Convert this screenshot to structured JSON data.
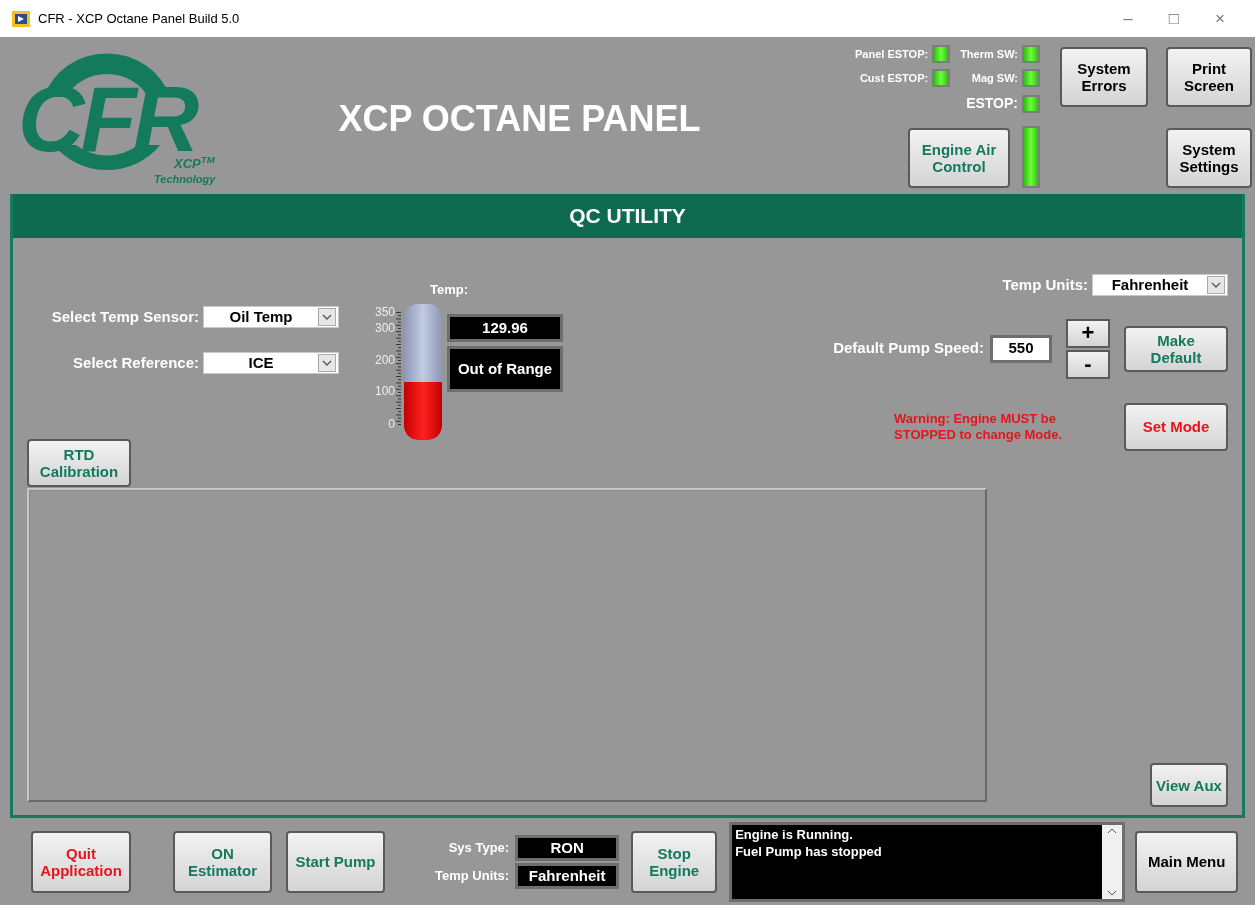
{
  "window": {
    "title": "CFR - XCP Octane Panel Build 5.0",
    "controls": [
      "–",
      "□",
      "×"
    ]
  },
  "header": {
    "logo": {
      "letters": "CFR",
      "mark": "XCP$^{TM}$",
      "sub": "Technology"
    },
    "title": "XCP OCTANE PANEL",
    "estop_lights": [
      {
        "label": "Panel ESTOP:",
        "on": true
      },
      {
        "label": "Cust ESTOP:",
        "on": true
      }
    ],
    "switch_lights": [
      {
        "label": "Therm SW:",
        "on": true,
        "kind": "small"
      },
      {
        "label": "Mag SW:",
        "on": true,
        "kind": "small"
      },
      {
        "label": "ESTOP:",
        "on": true,
        "kind": "large"
      }
    ],
    "engine_air": {
      "label": "Engine Air Control",
      "kind": "action",
      "on": true
    },
    "system_errors": {
      "label": "System Errors",
      "kind": "plain"
    },
    "print_screen": {
      "label": "Print Screen",
      "kind": "plain"
    },
    "system_settings": {
      "label": "System Settings",
      "kind": "plain"
    }
  },
  "section": {
    "title": "QC UTILITY"
  },
  "temp_sensor": {
    "label": "Select Temp Sensor:",
    "value": "Oil Temp"
  },
  "reference": {
    "label": "Select Reference:",
    "value": "ICE"
  },
  "rtd_button": {
    "label": "RTD Calibration",
    "kind": "action"
  },
  "thermometer": {
    "label": "Temp:",
    "scale": [
      "350",
      "300",
      "200",
      "100",
      "0"
    ],
    "level": 0.371,
    "reading": "129.96",
    "status": "Out of Range"
  },
  "temp_units": {
    "label": "Temp Units:",
    "value": "Fahrenheit"
  },
  "pump_speed": {
    "label": "Default Pump Speed:",
    "value": "550",
    "increment": "+",
    "decrement": "-"
  },
  "make_default": {
    "label": "Make Default",
    "kind": "action"
  },
  "warning": "Warning:  Engine MUST be STOPPED to change Mode.",
  "set_mode": {
    "label": "Set Mode",
    "kind": "danger"
  },
  "view_aux": {
    "label": "View Aux",
    "kind": "action"
  },
  "footer": {
    "buttons": [
      {
        "label": "Quit Application",
        "kind": "danger"
      },
      {
        "label": "ON Estimator",
        "kind": "action"
      },
      {
        "label": "Start Pump",
        "kind": "action"
      }
    ],
    "sys_type": {
      "label": "Sys Type:",
      "value": "RON"
    },
    "temp_units": {
      "label": "Temp Units:",
      "value": "Fahrenheit"
    },
    "stop_engine": {
      "label": "Stop Engine",
      "kind": "action"
    },
    "messages": [
      "Engine is Running.",
      "Fuel Pump has stopped"
    ],
    "main_menu": {
      "label": "Main Menu",
      "kind": "plain"
    }
  }
}
